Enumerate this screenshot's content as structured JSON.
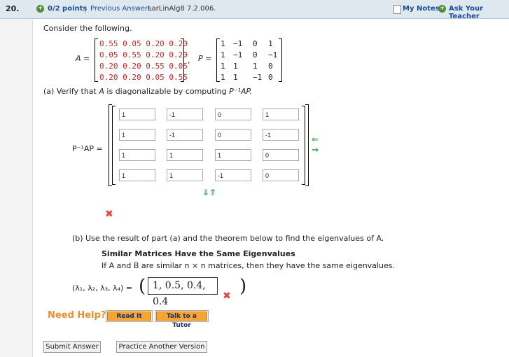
{
  "header": {
    "question_number": "20.",
    "points_icon": "plus-circle-icon",
    "points": "0/2 points",
    "separator": "|",
    "previous_answers": "Previous Answers",
    "source": "LarLinAlg8 7.2.006.",
    "notes_icon": "notepad-icon",
    "my_notes": "My Notes",
    "ask_icon": "plus-circle-icon",
    "ask_teacher": "Ask Your Teacher"
  },
  "prompt": "Consider the following.",
  "matrixA": {
    "label": "A =",
    "rows": [
      [
        "0.55",
        "0.05",
        "0.20",
        "0.20"
      ],
      [
        "0.05",
        "0.55",
        "0.20",
        "0.20"
      ],
      [
        "0.20",
        "0.20",
        "0.55",
        "0.05"
      ],
      [
        "0.20",
        "0.20",
        "0.05",
        "0.55"
      ]
    ],
    "comma": ","
  },
  "matrixP": {
    "label": "P =",
    "rows": [
      [
        "1",
        "−1",
        "0",
        "1"
      ],
      [
        "1",
        "−1",
        "0",
        "−1"
      ],
      [
        "1",
        "1",
        "1",
        "0"
      ],
      [
        "1",
        "1",
        "−1",
        "0"
      ]
    ]
  },
  "partA": {
    "text_prefix": "(a) Verify that",
    "var_a": "A",
    "text_mid": "is diagonalizable by computing",
    "expr": "P⁻¹AP.",
    "matrix_label": "P⁻¹AP =",
    "cells": [
      [
        "1",
        "-1",
        "0",
        "1"
      ],
      [
        "1",
        "-1",
        "0",
        "-1"
      ],
      [
        "1",
        "1",
        "1",
        "0"
      ],
      [
        "1",
        "1",
        "-1",
        "0"
      ]
    ],
    "arrow_left": "⇐",
    "arrow_right": "⇒",
    "arrow_down": "⇓",
    "arrow_up": "⇑",
    "incorrect_mark": "✖"
  },
  "partB": {
    "text": "(b) Use the result of part (a) and the theorem below to find the eigenvalues of A.",
    "theorem_title": "Similar Matrices Have the Same Eigenvalues",
    "theorem_text": "If A and B are similar n × n matrices, then they have the same eigenvalues.",
    "lambda_label": "(λ₁, λ₂, λ₃, λ₄) =",
    "paren_open": "(",
    "paren_close": ")",
    "answer_value": "1, 0.5, 0.4, 0.4",
    "incorrect_mark": "✖"
  },
  "help": {
    "label": "Need Help?",
    "read_it": "Read It",
    "talk_to_tutor": "Talk to a Tutor"
  },
  "footer": {
    "submit": "Submit Answer",
    "practice": "Practice Another Version"
  },
  "colors": {
    "header_bg": "#dfe8ef",
    "link": "#1a4f96",
    "matrix_red": "#c62828",
    "arrow_green": "#3aa34a",
    "incorrect_red": "#e84545",
    "help_orange": "#e8912a",
    "button_orange": "#f6a531"
  }
}
